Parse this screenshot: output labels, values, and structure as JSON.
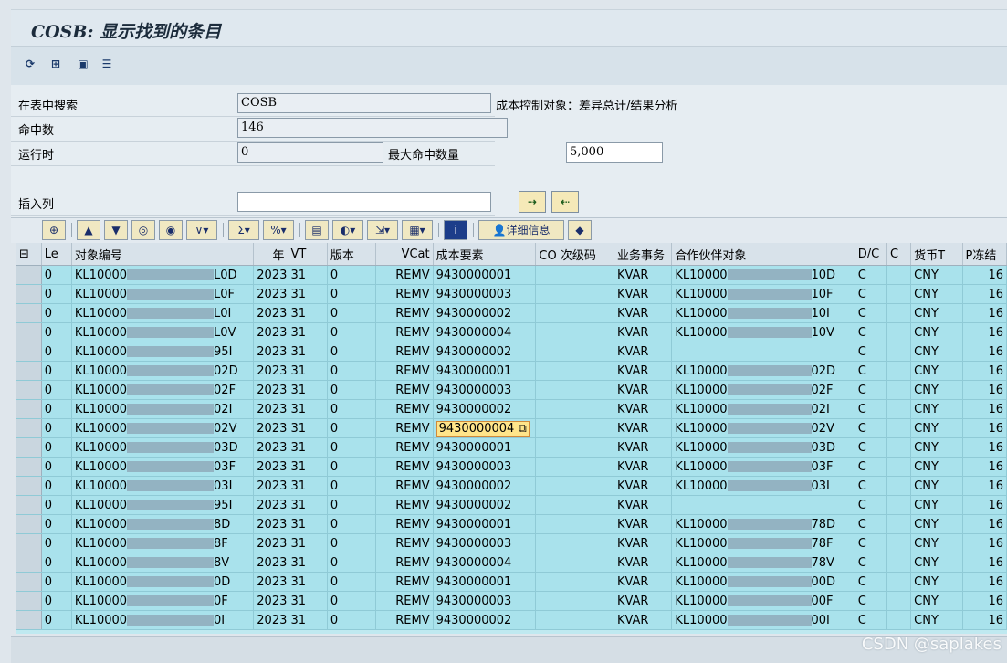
{
  "window": {
    "title": "COSB: 显示找到的条目"
  },
  "app_toolbar": {
    "icons": [
      "refresh-icon",
      "table-settings-icon",
      "save-icon",
      "list-icon"
    ]
  },
  "form": {
    "search_table_label": "在表中搜索",
    "search_table_value": "COSB",
    "search_table_desc": "成本控制对象：差异总计/结果分析",
    "hits_label": "命中数",
    "hits_value": "146",
    "runtime_label": "运行时",
    "runtime_value": "0",
    "max_hits_label": "最大命中数量",
    "max_hits_value": "5,000",
    "insert_col_label": "插入列",
    "insert_col_value": ""
  },
  "alv_toolbar": {
    "detail_label": "详细信息"
  },
  "table": {
    "columns": [
      "Le",
      "对象编号",
      "年",
      "VT",
      "版本",
      "VCat",
      "成本要素",
      "CO 次级码",
      "业务事务",
      "合作伙伴对象",
      "D/C",
      "C",
      "货币T",
      "P冻结"
    ],
    "rows": [
      [
        "0",
        "KL10000",
        "L0D",
        "2023",
        "31",
        "0",
        "REMV",
        "9430000001",
        "",
        "KVAR",
        "KL10000",
        "10D",
        "C",
        "",
        "CNY",
        "16"
      ],
      [
        "0",
        "KL10000",
        "L0F",
        "2023",
        "31",
        "0",
        "REMV",
        "9430000003",
        "",
        "KVAR",
        "KL10000",
        "10F",
        "C",
        "",
        "CNY",
        "16"
      ],
      [
        "0",
        "KL10000",
        "L0I",
        "2023",
        "31",
        "0",
        "REMV",
        "9430000002",
        "",
        "KVAR",
        "KL10000",
        "10I",
        "C",
        "",
        "CNY",
        "16"
      ],
      [
        "0",
        "KL10000",
        "L0V",
        "2023",
        "31",
        "0",
        "REMV",
        "9430000004",
        "",
        "KVAR",
        "KL10000",
        "10V",
        "C",
        "",
        "CNY",
        "16"
      ],
      [
        "0",
        "KL10000",
        "95I",
        "2023",
        "31",
        "0",
        "REMV",
        "9430000002",
        "",
        "KVAR",
        "",
        "",
        "C",
        "",
        "CNY",
        "16"
      ],
      [
        "0",
        "KL10000",
        "02D",
        "2023",
        "31",
        "0",
        "REMV",
        "9430000001",
        "",
        "KVAR",
        "KL10000",
        "02D",
        "C",
        "",
        "CNY",
        "16"
      ],
      [
        "0",
        "KL10000",
        "02F",
        "2023",
        "31",
        "0",
        "REMV",
        "9430000003",
        "",
        "KVAR",
        "KL10000",
        "02F",
        "C",
        "",
        "CNY",
        "16"
      ],
      [
        "0",
        "KL10000",
        "02I",
        "2023",
        "31",
        "0",
        "REMV",
        "9430000002",
        "",
        "KVAR",
        "KL10000",
        "02I",
        "C",
        "",
        "CNY",
        "16"
      ],
      [
        "0",
        "KL10000",
        "02V",
        "2023",
        "31",
        "0",
        "REMV",
        "9430000004",
        "",
        "KVAR",
        "KL10000",
        "02V",
        "C",
        "",
        "CNY",
        "16"
      ],
      [
        "0",
        "KL10000",
        "03D",
        "2023",
        "31",
        "0",
        "REMV",
        "9430000001",
        "",
        "KVAR",
        "KL10000",
        "03D",
        "C",
        "",
        "CNY",
        "16"
      ],
      [
        "0",
        "KL10000",
        "03F",
        "2023",
        "31",
        "0",
        "REMV",
        "9430000003",
        "",
        "KVAR",
        "KL10000",
        "03F",
        "C",
        "",
        "CNY",
        "16"
      ],
      [
        "0",
        "KL10000",
        "03I",
        "2023",
        "31",
        "0",
        "REMV",
        "9430000002",
        "",
        "KVAR",
        "KL10000",
        "03I",
        "C",
        "",
        "CNY",
        "16"
      ],
      [
        "0",
        "KL10000",
        "95I",
        "2023",
        "31",
        "0",
        "REMV",
        "9430000002",
        "",
        "KVAR",
        "",
        "",
        "C",
        "",
        "CNY",
        "16"
      ],
      [
        "0",
        "KL10000",
        "8D",
        "2023",
        "31",
        "0",
        "REMV",
        "9430000001",
        "",
        "KVAR",
        "KL10000",
        "78D",
        "C",
        "",
        "CNY",
        "16"
      ],
      [
        "0",
        "KL10000",
        "8F",
        "2023",
        "31",
        "0",
        "REMV",
        "9430000003",
        "",
        "KVAR",
        "KL10000",
        "78F",
        "C",
        "",
        "CNY",
        "16"
      ],
      [
        "0",
        "KL10000",
        "8V",
        "2023",
        "31",
        "0",
        "REMV",
        "9430000004",
        "",
        "KVAR",
        "KL10000",
        "78V",
        "C",
        "",
        "CNY",
        "16"
      ],
      [
        "0",
        "KL10000",
        "0D",
        "2023",
        "31",
        "0",
        "REMV",
        "9430000001",
        "",
        "KVAR",
        "KL10000",
        "00D",
        "C",
        "",
        "CNY",
        "16"
      ],
      [
        "0",
        "KL10000",
        "0F",
        "2023",
        "31",
        "0",
        "REMV",
        "9430000003",
        "",
        "KVAR",
        "KL10000",
        "00F",
        "C",
        "",
        "CNY",
        "16"
      ],
      [
        "0",
        "KL10000",
        "0I",
        "2023",
        "31",
        "0",
        "REMV",
        "9430000002",
        "",
        "KVAR",
        "KL10000",
        "00I",
        "C",
        "",
        "CNY",
        "16"
      ]
    ],
    "selected_row": 8
  },
  "watermark": "CSDN @saplakes"
}
